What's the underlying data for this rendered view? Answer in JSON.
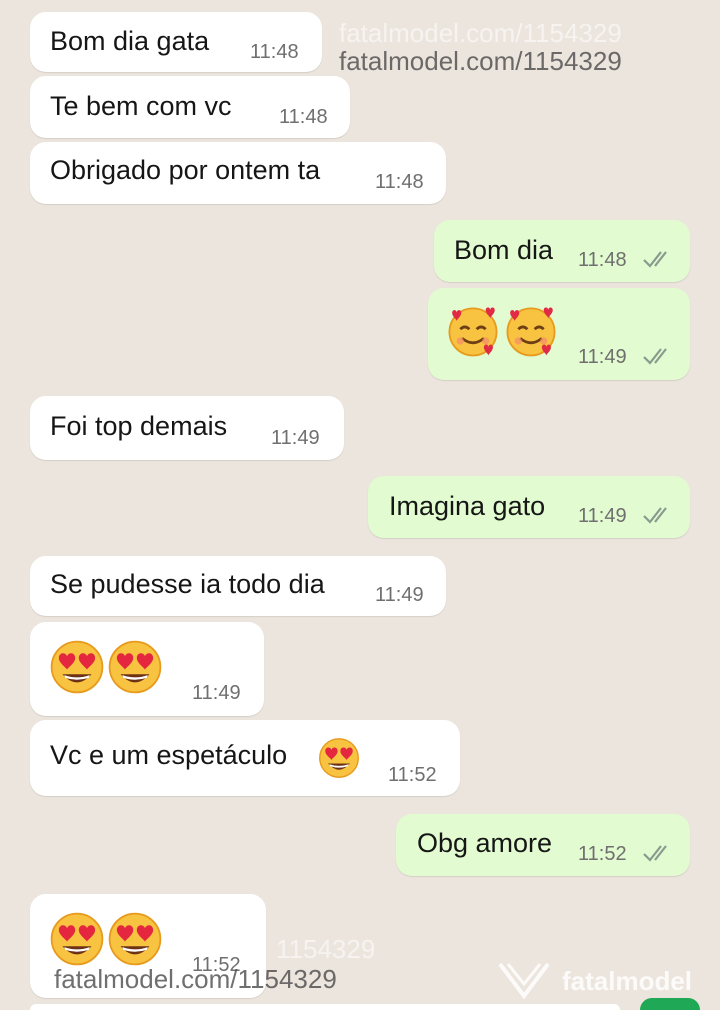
{
  "watermarks": {
    "top": "fatalmodel.com/1154329",
    "top_faint": "fatalmodel.com/1154329",
    "bottom": "fatalmodel.com/1154329",
    "bottom_faint": "1154329",
    "logo": "fatalmodel"
  },
  "messages": [
    {
      "dir": "in",
      "text": "Bom dia gata",
      "time": "11:48"
    },
    {
      "dir": "in",
      "text": "Te bem com vc",
      "time": "11:48"
    },
    {
      "dir": "in",
      "text": "Obrigado por ontem ta",
      "time": "11:48"
    },
    {
      "dir": "out",
      "text": "Bom dia",
      "time": "11:48",
      "status": "read"
    },
    {
      "dir": "out",
      "emoji": [
        "smiling-face-with-hearts",
        "smiling-face-with-hearts"
      ],
      "time": "11:49",
      "status": "read"
    },
    {
      "dir": "in",
      "text": "Foi top demais",
      "time": "11:49"
    },
    {
      "dir": "out",
      "text": "Imagina gato",
      "time": "11:49",
      "status": "read"
    },
    {
      "dir": "in",
      "text": "Se pudesse ia todo dia",
      "time": "11:49"
    },
    {
      "dir": "in",
      "emoji": [
        "heart-eyes-face",
        "heart-eyes-face"
      ],
      "time": "11:49"
    },
    {
      "dir": "in",
      "text": "Vc e um espetáculo",
      "emoji": [
        "heart-eyes-face"
      ],
      "time": "11:52"
    },
    {
      "dir": "out",
      "text": "Obg amore",
      "time": "11:52",
      "status": "read"
    },
    {
      "dir": "in",
      "emoji": [
        "heart-eyes-face",
        "heart-eyes-face"
      ],
      "time": "11:52"
    }
  ],
  "colors": {
    "background": "#ece5dd",
    "incoming": "#ffffff",
    "outgoing": "#e2fbd0",
    "read_ticks": "#8a9a8e"
  }
}
